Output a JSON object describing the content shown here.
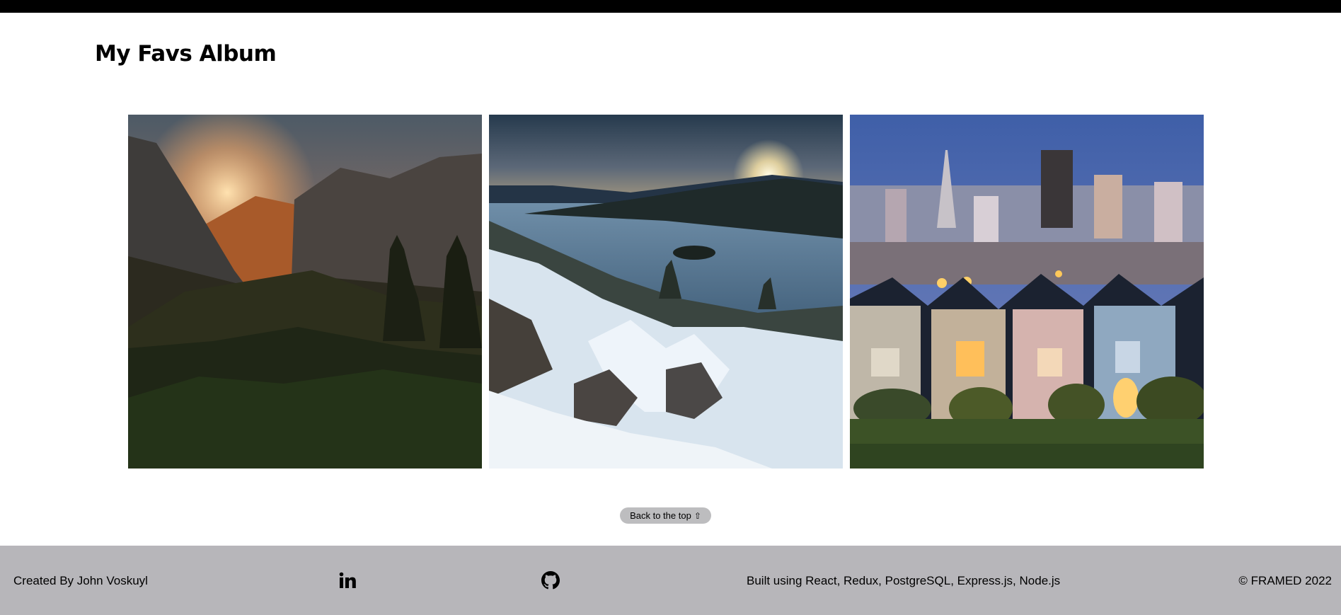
{
  "header": {
    "title": "My Favs Album"
  },
  "gallery": {
    "photos": [
      {
        "icon": "mountain-valley-sunset-image"
      },
      {
        "icon": "snowy-lake-sunburst-image"
      },
      {
        "icon": "city-skyline-victorian-houses-image"
      }
    ]
  },
  "back_to_top": {
    "label": "Back to the top",
    "icon": "⇧"
  },
  "footer": {
    "credit": "Created By John Voskuyl",
    "linkedin_icon": "linkedin-icon",
    "github_icon": "github-icon",
    "built_with": "Built using React, Redux, PostgreSQL, Express.js, Node.js",
    "copyright": "© FRAMED 2022"
  },
  "colors": {
    "topbar": "#000000",
    "footer_bg": "#b7b6ba",
    "button_bg": "#bdbdbf"
  }
}
